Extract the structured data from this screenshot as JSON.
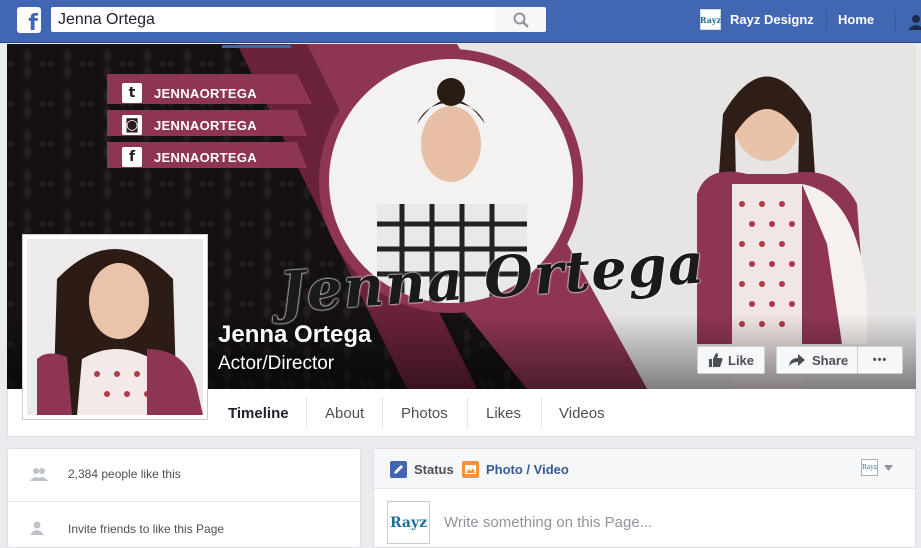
{
  "topbar": {
    "logo_letter": "f",
    "search_value": "Jenna Ortega",
    "user_name": "Rayz Designz",
    "user_avatar_text": "Rayz",
    "home_label": "Home"
  },
  "cover": {
    "social_handles": [
      {
        "icon": "twitter-icon",
        "glyph": "t",
        "handle": "JENNAORTEGA"
      },
      {
        "icon": "instagram-icon",
        "glyph": "◙",
        "handle": "JENNAORTEGA"
      },
      {
        "icon": "facebook-icon",
        "glyph": "f",
        "handle": "JENNAORTEGA"
      }
    ],
    "signature": "Jenna Ortega",
    "accent_color": "#8e3553"
  },
  "page": {
    "name": "Jenna Ortega",
    "category": "Actor/Director"
  },
  "actions": {
    "like_label": "Like",
    "share_label": "Share",
    "more_label": "•••"
  },
  "tabs": [
    "Timeline",
    "About",
    "Photos",
    "Likes",
    "Videos"
  ],
  "sidebar": {
    "likes_text": "2,384 people like this",
    "invite_text": "Invite friends to like this Page"
  },
  "composer": {
    "status_label": "Status",
    "photo_label": "Photo / Video",
    "placeholder": "Write something on this Page...",
    "avatar_text": "Rayz"
  },
  "colors": {
    "facebook_blue": "#4267b2",
    "link_blue": "#365899"
  }
}
